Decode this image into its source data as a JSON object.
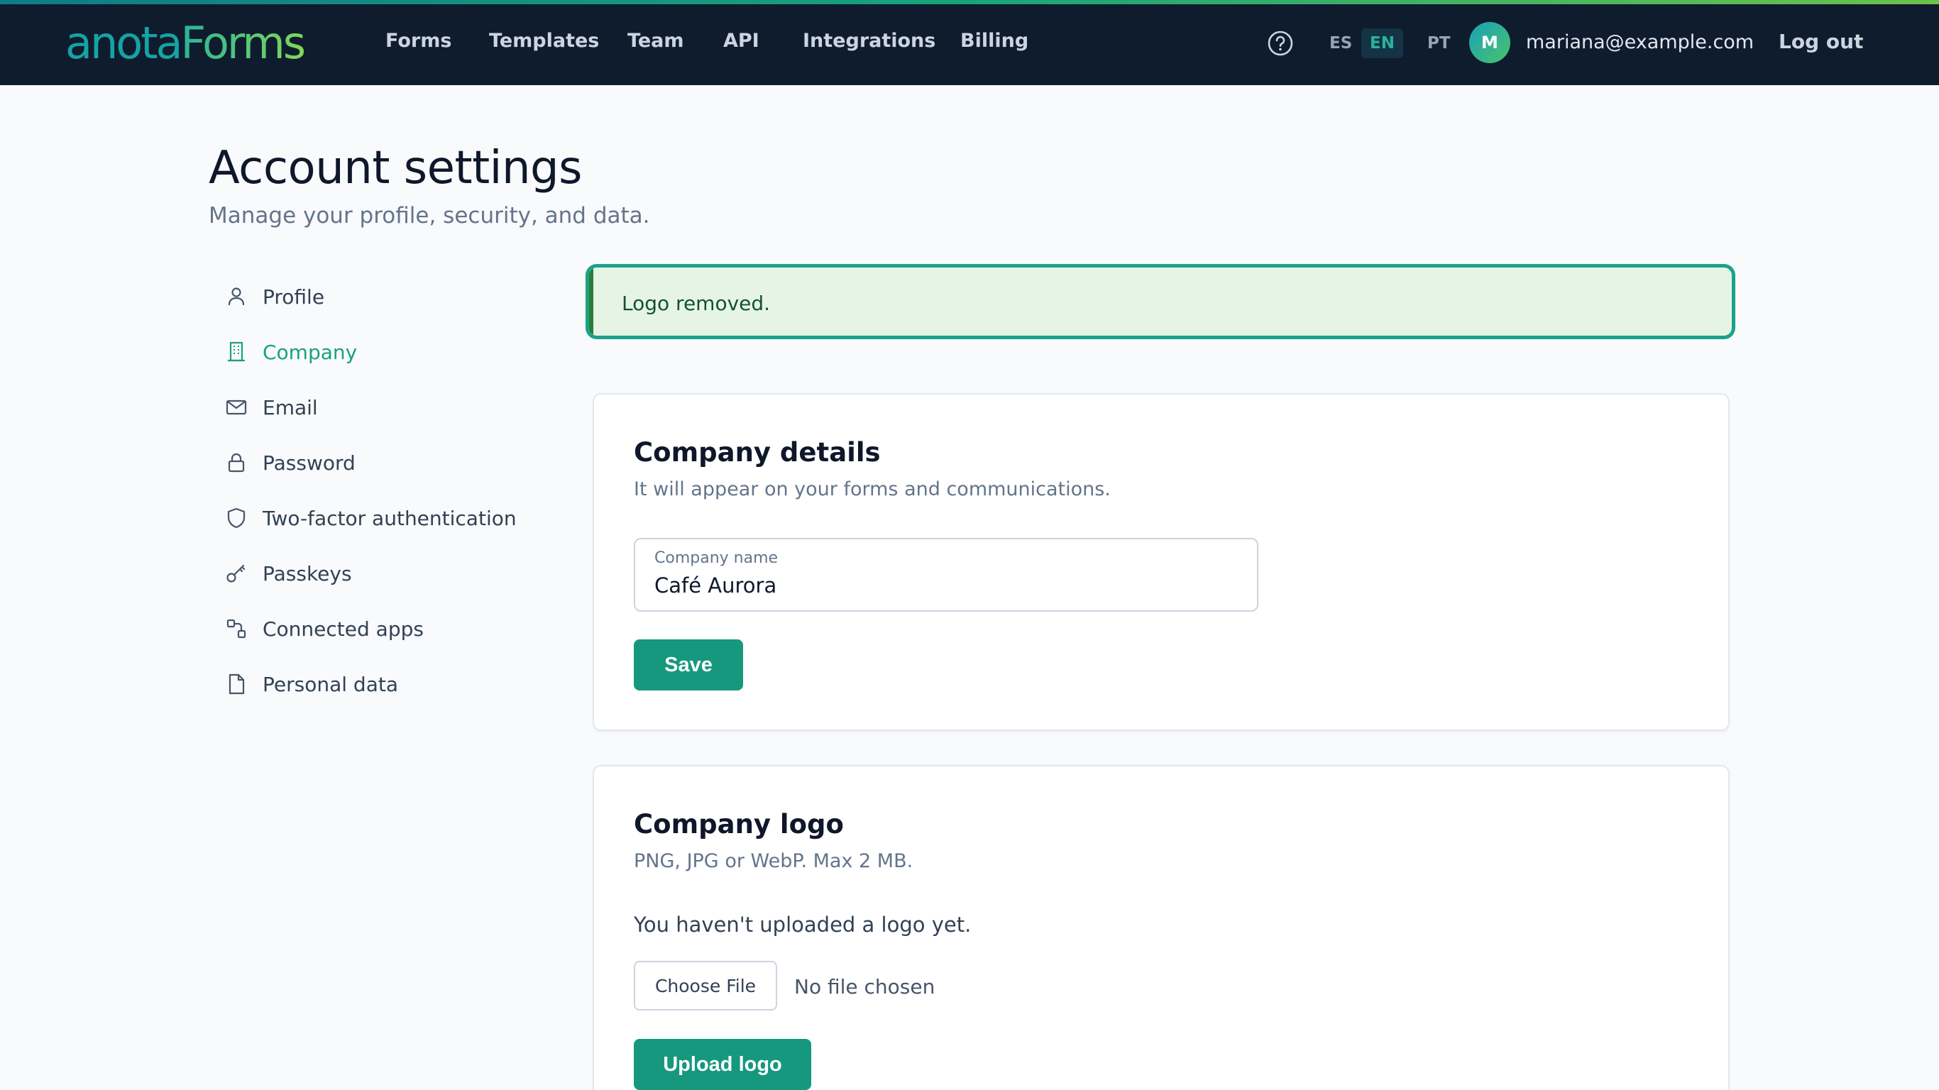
{
  "app": {
    "logo_part1": "anota",
    "logo_part2": "Forms"
  },
  "nav": {
    "items": [
      "Forms",
      "Templates",
      "Team",
      "API",
      "Integrations",
      "Billing"
    ]
  },
  "header": {
    "languages": [
      "ES",
      "EN",
      "PT"
    ],
    "active_language": "EN",
    "avatar_initial": "M",
    "user_email": "mariana@example.com",
    "logout_label": "Log out"
  },
  "page": {
    "title": "Account settings",
    "subtitle": "Manage your profile, security, and data."
  },
  "sidebar": {
    "items": [
      {
        "label": "Profile",
        "icon": "user-icon"
      },
      {
        "label": "Company",
        "icon": "building-icon"
      },
      {
        "label": "Email",
        "icon": "mail-icon"
      },
      {
        "label": "Password",
        "icon": "lock-icon"
      },
      {
        "label": "Two-factor authentication",
        "icon": "shield-icon"
      },
      {
        "label": "Passkeys",
        "icon": "key-icon"
      },
      {
        "label": "Connected apps",
        "icon": "apps-icon"
      },
      {
        "label": "Personal data",
        "icon": "file-icon"
      }
    ],
    "active_item": "Company"
  },
  "alert": {
    "message": "Logo removed."
  },
  "company_details": {
    "title": "Company details",
    "description": "It will appear on your forms and communications.",
    "name_label": "Company name",
    "name_value": "Café Aurora",
    "save_label": "Save"
  },
  "company_logo": {
    "title": "Company logo",
    "description": "PNG, JPG or WebP. Max 2 MB.",
    "empty_text": "You haven't uploaded a logo yet.",
    "choose_file_label": "Choose File",
    "file_status": "No file chosen",
    "upload_label": "Upload logo"
  },
  "colors": {
    "header_bg": "#0f1c2e",
    "accent": "#1aa37a",
    "primary_button": "#16987e",
    "alert_border": "#1aa38a",
    "alert_bg": "#e6f4e6"
  }
}
